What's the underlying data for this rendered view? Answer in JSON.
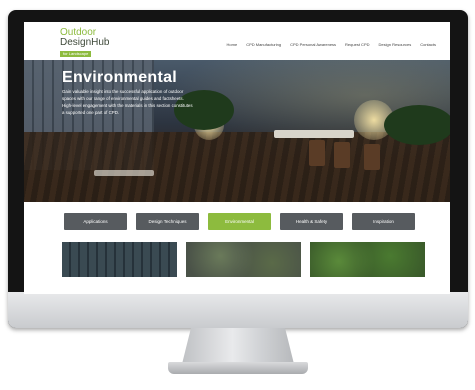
{
  "logo": {
    "line1": "Outdoor",
    "line2": "Design",
    "hub": "Hub",
    "badge": "for Landscape"
  },
  "nav": {
    "items": [
      {
        "label": "Home"
      },
      {
        "label": "CPD Manufacturing"
      },
      {
        "label": "CPD Personal Awareness"
      },
      {
        "label": "Request CPD"
      },
      {
        "label": "Design Resources"
      },
      {
        "label": "Contacts"
      }
    ]
  },
  "hero": {
    "title": "Environmental",
    "text": "Gain valuable insight into the successful application of outdoor spaces with our range of environmental guides and factsheets. High-level engagement with the materials in this section constitutes a supported one part of CPD."
  },
  "tabs": [
    {
      "label": "Applications",
      "active": false
    },
    {
      "label": "Design Techniques",
      "active": false
    },
    {
      "label": "Environmental",
      "active": true
    },
    {
      "label": "Health & Safety",
      "active": false
    },
    {
      "label": "Inspiration",
      "active": false
    }
  ],
  "colors": {
    "accent": "#8dbb3e",
    "tab": "#575b5f",
    "bezel": "#141414"
  }
}
